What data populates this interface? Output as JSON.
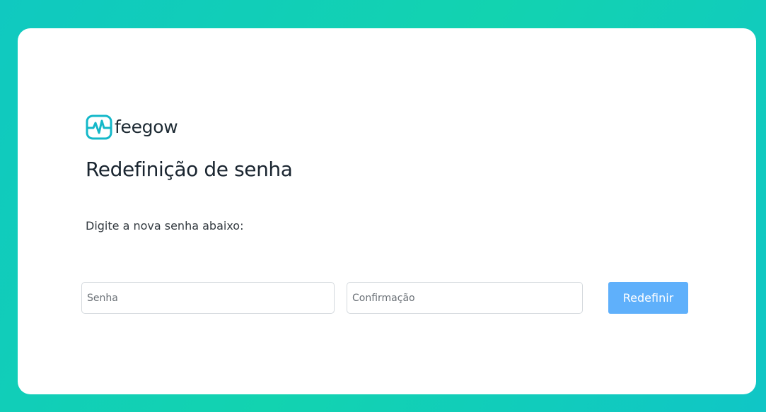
{
  "brand": {
    "name": "feegow",
    "icon": "pulse-monitor-icon",
    "accent_color": "#14b8c9"
  },
  "page": {
    "title": "Redefinição de senha",
    "instruction": "Digite a nova senha abaixo:"
  },
  "form": {
    "password_placeholder": "Senha",
    "password_value": "",
    "confirm_placeholder": "Confirmação",
    "confirm_value": "",
    "submit_label": "Redefinir",
    "submit_color": "#5fb0fb"
  },
  "colors": {
    "background_gradient_start": "#10c9c0",
    "background_gradient_end": "#10c6c6",
    "card": "#ffffff"
  }
}
